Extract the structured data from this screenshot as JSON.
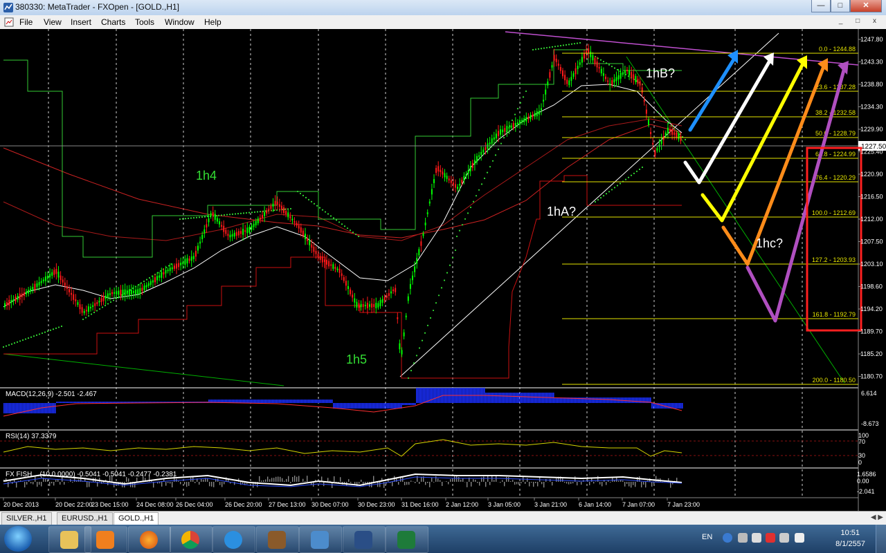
{
  "window": {
    "title": "380330: MetaTrader - FXOpen - [GOLD.,H1]"
  },
  "menu": [
    "File",
    "View",
    "Insert",
    "Charts",
    "Tools",
    "Window",
    "Help"
  ],
  "price_axis": [
    "1247.80",
    "1243.30",
    "1238.80",
    "1234.30",
    "1229.90",
    "1225.40",
    "1220.90",
    "1216.50",
    "1212.00",
    "1207.50",
    "1203.10",
    "1198.60",
    "1194.20",
    "1189.70",
    "1185.20",
    "1180.70"
  ],
  "current_price": "1227.50",
  "fib_levels": [
    {
      "label": "0.0 - 1244.88"
    },
    {
      "label": "23.6 - 1237.28"
    },
    {
      "label": "38.2 - 1232.58"
    },
    {
      "label": "50.0 - 1228.79"
    },
    {
      "label": "61.8 - 1224.99"
    },
    {
      "label": "76.4 - 1220.29"
    },
    {
      "label": "100.0 - 1212.69"
    },
    {
      "label": "127.2 - 1203.93"
    },
    {
      "label": "161.8 - 1192.79"
    },
    {
      "label": "200.0 - 1180.50"
    }
  ],
  "annotations": {
    "wave_1h4": "1h4",
    "wave_1h5": "1h5",
    "wave_1hA": "1hA?",
    "wave_1hB": "1hB?",
    "wave_1hc": "1hc?"
  },
  "macd": {
    "label": "MACD(12,26,9) -2.501 -2.467",
    "axis_top": "6.614",
    "axis_bottom": "-8.673"
  },
  "rsi": {
    "label": "RSI(14) 37.3379",
    "axis": [
      "100",
      "70",
      "30",
      "0"
    ]
  },
  "fisher": {
    "label": "FX FISH ...(10,0.0000) -0.5041 -0.5041 -0.2477 -0.2381",
    "axis": [
      "1.6586",
      "0.00",
      "-2.041"
    ]
  },
  "time_axis": [
    "20 Dec 2013",
    "20 Dec 22:00",
    "23 Dec 15:00",
    "24 Dec 08:00",
    "26 Dec 04:00",
    "26 Dec 20:00",
    "27 Dec 13:00",
    "30 Dec 07:00",
    "30 Dec 23:00",
    "31 Dec 16:00",
    "2 Jan 12:00",
    "3 Jan 05:00",
    "3 Jan 21:00",
    "6 Jan 14:00",
    "7 Jan 07:00",
    "7 Jan 23:00"
  ],
  "tabs": [
    {
      "label": "SILVER.,H1"
    },
    {
      "label": "EURUSD.,H1"
    },
    {
      "label": "GOLD.,H1"
    }
  ],
  "tray": {
    "lang": "EN",
    "time": "10:51",
    "date": "8/1/2557"
  },
  "colors": {
    "fib": "#ffff00",
    "bull": "#00ff00",
    "bear": "#ff0000",
    "arrow_blue": "#1e90ff",
    "arrow_white": "#ffffff",
    "arrow_yellow": "#ffff00",
    "arrow_orange": "#ff8c1a",
    "arrow_purple": "#b04fc0",
    "highlight_box": "#ff2020"
  }
}
